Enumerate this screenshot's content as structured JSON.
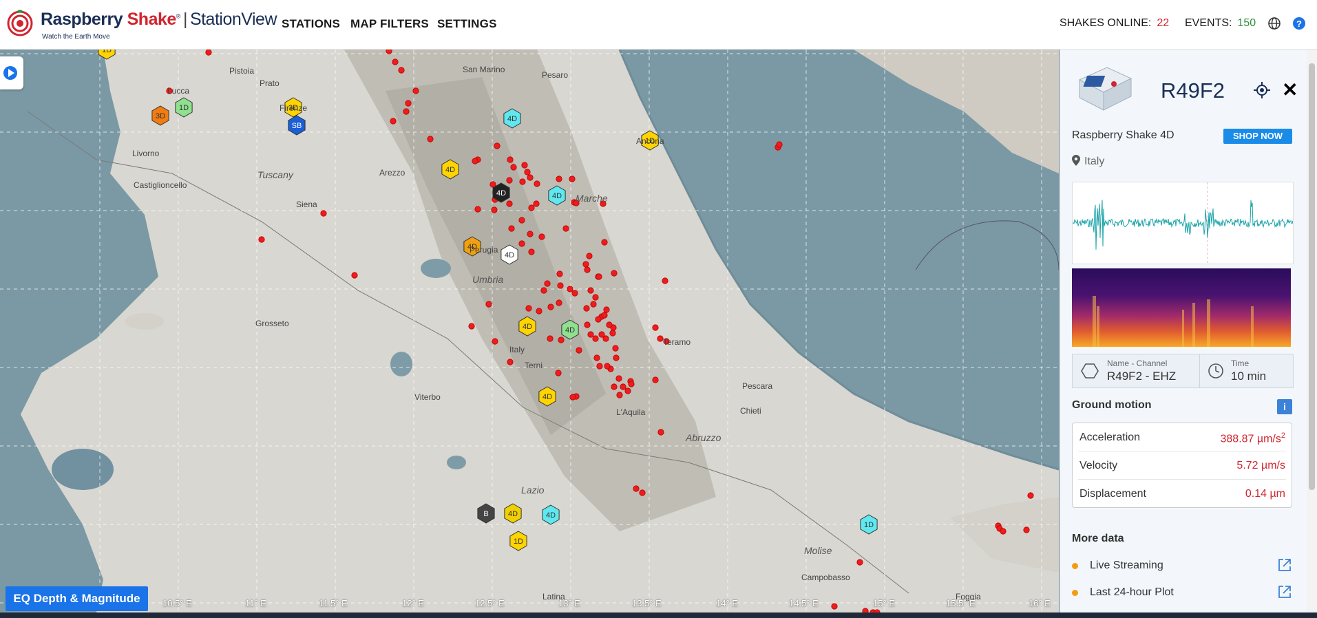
{
  "header": {
    "logo_brand": "Raspberry",
    "logo_brand_accent": "Shake",
    "logo_app": "StationView",
    "logo_tagline": "Watch the Earth Move",
    "nav": [
      "STATIONS",
      "MAP FILTERS",
      "SETTINGS"
    ],
    "shakes_label": "SHAKES ONLINE:",
    "shakes_value": "22",
    "events_label": "EVENTS:",
    "events_value": "150",
    "icons": [
      "globe-icon",
      "help-icon"
    ]
  },
  "map": {
    "labels": [
      "Pistoia",
      "Prato",
      "Lucca",
      "Firenze",
      "Livorno",
      "Castiglioncello",
      "Tuscany",
      "Arezzo",
      "Siena",
      "Grosseto",
      "Umbria",
      "Perugia",
      "Italy",
      "Terni",
      "Viterbo",
      "Lazio",
      "Latina",
      "San Marino",
      "Pesaro",
      "Ancona",
      "Marche",
      "Teramo",
      "Pescara",
      "Chieti",
      "L'Aquila",
      "Abruzzo",
      "Molise",
      "Campobasso",
      "Foggia"
    ],
    "lon_ticks": [
      "10.5° E",
      "11° E",
      "11.5° E",
      "12° E",
      "12.5° E",
      "13° E",
      "13.5° E",
      "14° E",
      "14.5° E",
      "15° E",
      "15.5° E",
      "16° E"
    ],
    "station_labels": [
      "3D",
      "1D",
      "3D",
      "SB",
      "4D",
      "1D",
      "4D",
      "4D",
      "4D",
      "4D",
      "4D",
      "4D",
      "4D",
      "4D",
      "4D",
      "B",
      "4D",
      "1D",
      "1D",
      "1D"
    ],
    "eq_button": "EQ Depth & Magnitude"
  },
  "panel": {
    "station_id": "R49F2",
    "model": "Raspberry Shake 4D",
    "shop_label": "SHOP NOW",
    "location": "Italy",
    "channel_label": "Name - Channel",
    "channel_value": "R49F2 - EHZ",
    "time_label": "Time",
    "time_value": "10 min",
    "ground_motion_title": "Ground motion",
    "ground_motion": [
      {
        "label": "Acceleration",
        "value": "388.87 µm/s",
        "sup": "2"
      },
      {
        "label": "Velocity",
        "value": "5.72 µm/s",
        "sup": ""
      },
      {
        "label": "Displacement",
        "value": "0.14 µm",
        "sup": ""
      }
    ],
    "more_data_title": "More data",
    "more_data": [
      "Live Streaming",
      "Last 24-hour Plot"
    ],
    "colors": {
      "accent": "#1a8ce8",
      "waveform": "#1aa3a8",
      "value_red": "#d2252f",
      "dot_orange": "#f39c12"
    }
  }
}
